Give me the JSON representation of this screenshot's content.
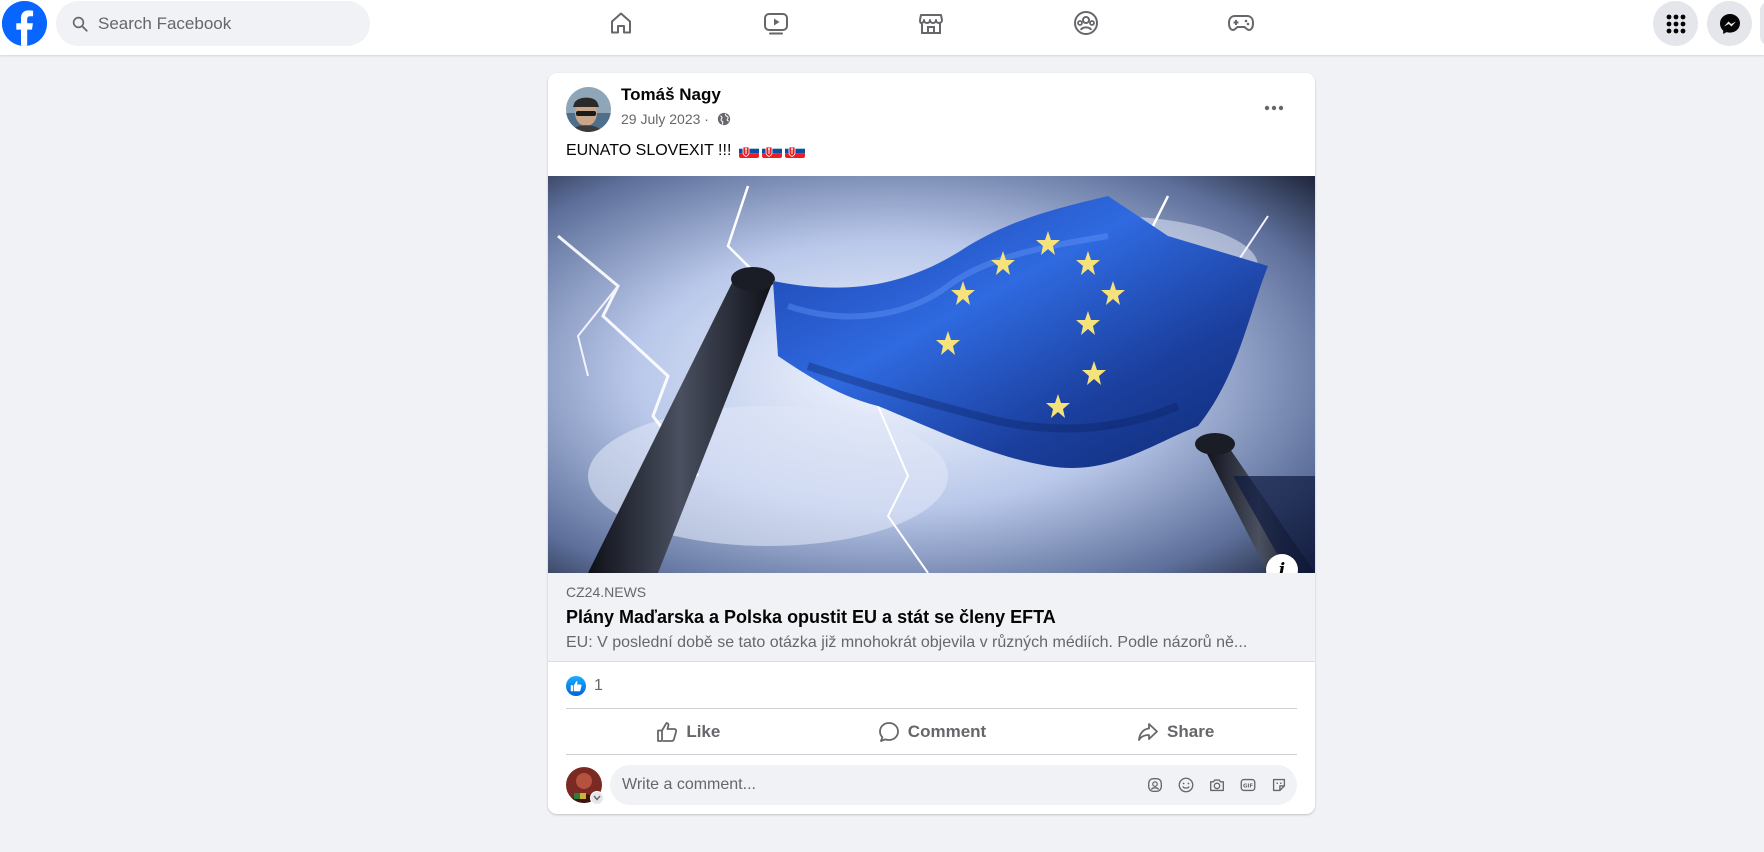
{
  "topbar": {
    "logo_icon": "facebook-logo",
    "search_placeholder": "Search Facebook",
    "nav_icons": [
      "home-icon",
      "video-icon",
      "marketplace-icon",
      "groups-icon",
      "gaming-icon"
    ],
    "right_icons": [
      "menu-grid-icon",
      "messenger-icon"
    ]
  },
  "post": {
    "author": "Tomáš Nagy",
    "date": "29 July 2023",
    "date_separator": " · ",
    "privacy_icon": "globe-icon",
    "text": "EUNATO SLOVEXIT !!!",
    "emoji_flags": [
      "slovakia-flag",
      "slovakia-flag",
      "slovakia-flag"
    ],
    "link": {
      "image_description_icon": "eu-flag-image",
      "info_glyph": "i",
      "domain": "CZ24.NEWS",
      "title": "Plány Maďarska a Polska opustit EU a stát se členy EFTA",
      "description": "EU: V poslední době se tato otázka již mnohokrát objevila v různých médiích. Podle názorů ně..."
    },
    "reactions": {
      "icon": "like-reaction-icon",
      "count": "1"
    },
    "actions": {
      "like": "Like",
      "comment": "Comment",
      "share": "Share"
    },
    "comment_placeholder": "Write a comment...",
    "comment_tools": [
      "avatar-sticker-icon",
      "emoji-icon",
      "camera-icon",
      "gif-icon",
      "sticker-icon"
    ]
  },
  "colors": {
    "brand": "#0866ff",
    "background": "#f0f2f5",
    "secondary_text": "#65676b"
  }
}
